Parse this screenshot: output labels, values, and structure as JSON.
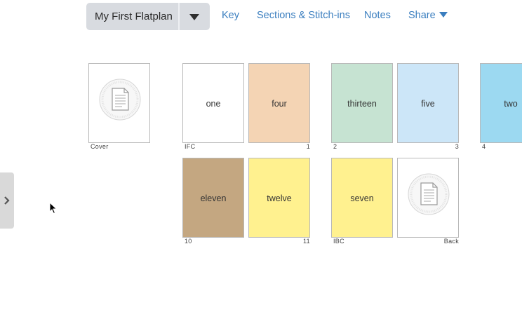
{
  "toolbar": {
    "flatplan_name": "My First Flatplan",
    "links": {
      "key": "Key",
      "sections": "Sections & Stitch-ins",
      "notes": "Notes",
      "share": "Share"
    }
  },
  "colors": {
    "link": "#3a7ebf",
    "white": "#ffffff",
    "peach": "#f4d4b4",
    "green": "#c6e3d2",
    "lightblue": "#cce6f8",
    "cyan": "#9cd9f1",
    "tan": "#c4a781",
    "yellow": "#fff18f"
  },
  "pages": [
    {
      "title": "",
      "icon": "document-placeholder-icon",
      "color": "#ffffff",
      "left_label": "Cover",
      "right_label": ""
    },
    {
      "title": "one",
      "color": "#ffffff",
      "left_label": "IFC",
      "right_label": ""
    },
    {
      "title": "four",
      "color": "#f4d4b4",
      "left_label": "",
      "right_label": "1"
    },
    {
      "title": "thirteen",
      "color": "#c6e3d2",
      "left_label": "2",
      "right_label": ""
    },
    {
      "title": "five",
      "color": "#cce6f8",
      "left_label": "",
      "right_label": "3"
    },
    {
      "title": "two",
      "color": "#9cd9f1",
      "left_label": "4",
      "right_label": ""
    },
    {
      "title": "eleven",
      "color": "#c4a781",
      "left_label": "10",
      "right_label": ""
    },
    {
      "title": "twelve",
      "color": "#fff18f",
      "left_label": "",
      "right_label": "11"
    },
    {
      "title": "seven",
      "color": "#fff18f",
      "left_label": "IBC",
      "right_label": ""
    },
    {
      "title": "",
      "icon": "document-placeholder-icon",
      "color": "#ffffff",
      "left_label": "",
      "right_label": "Back"
    }
  ]
}
